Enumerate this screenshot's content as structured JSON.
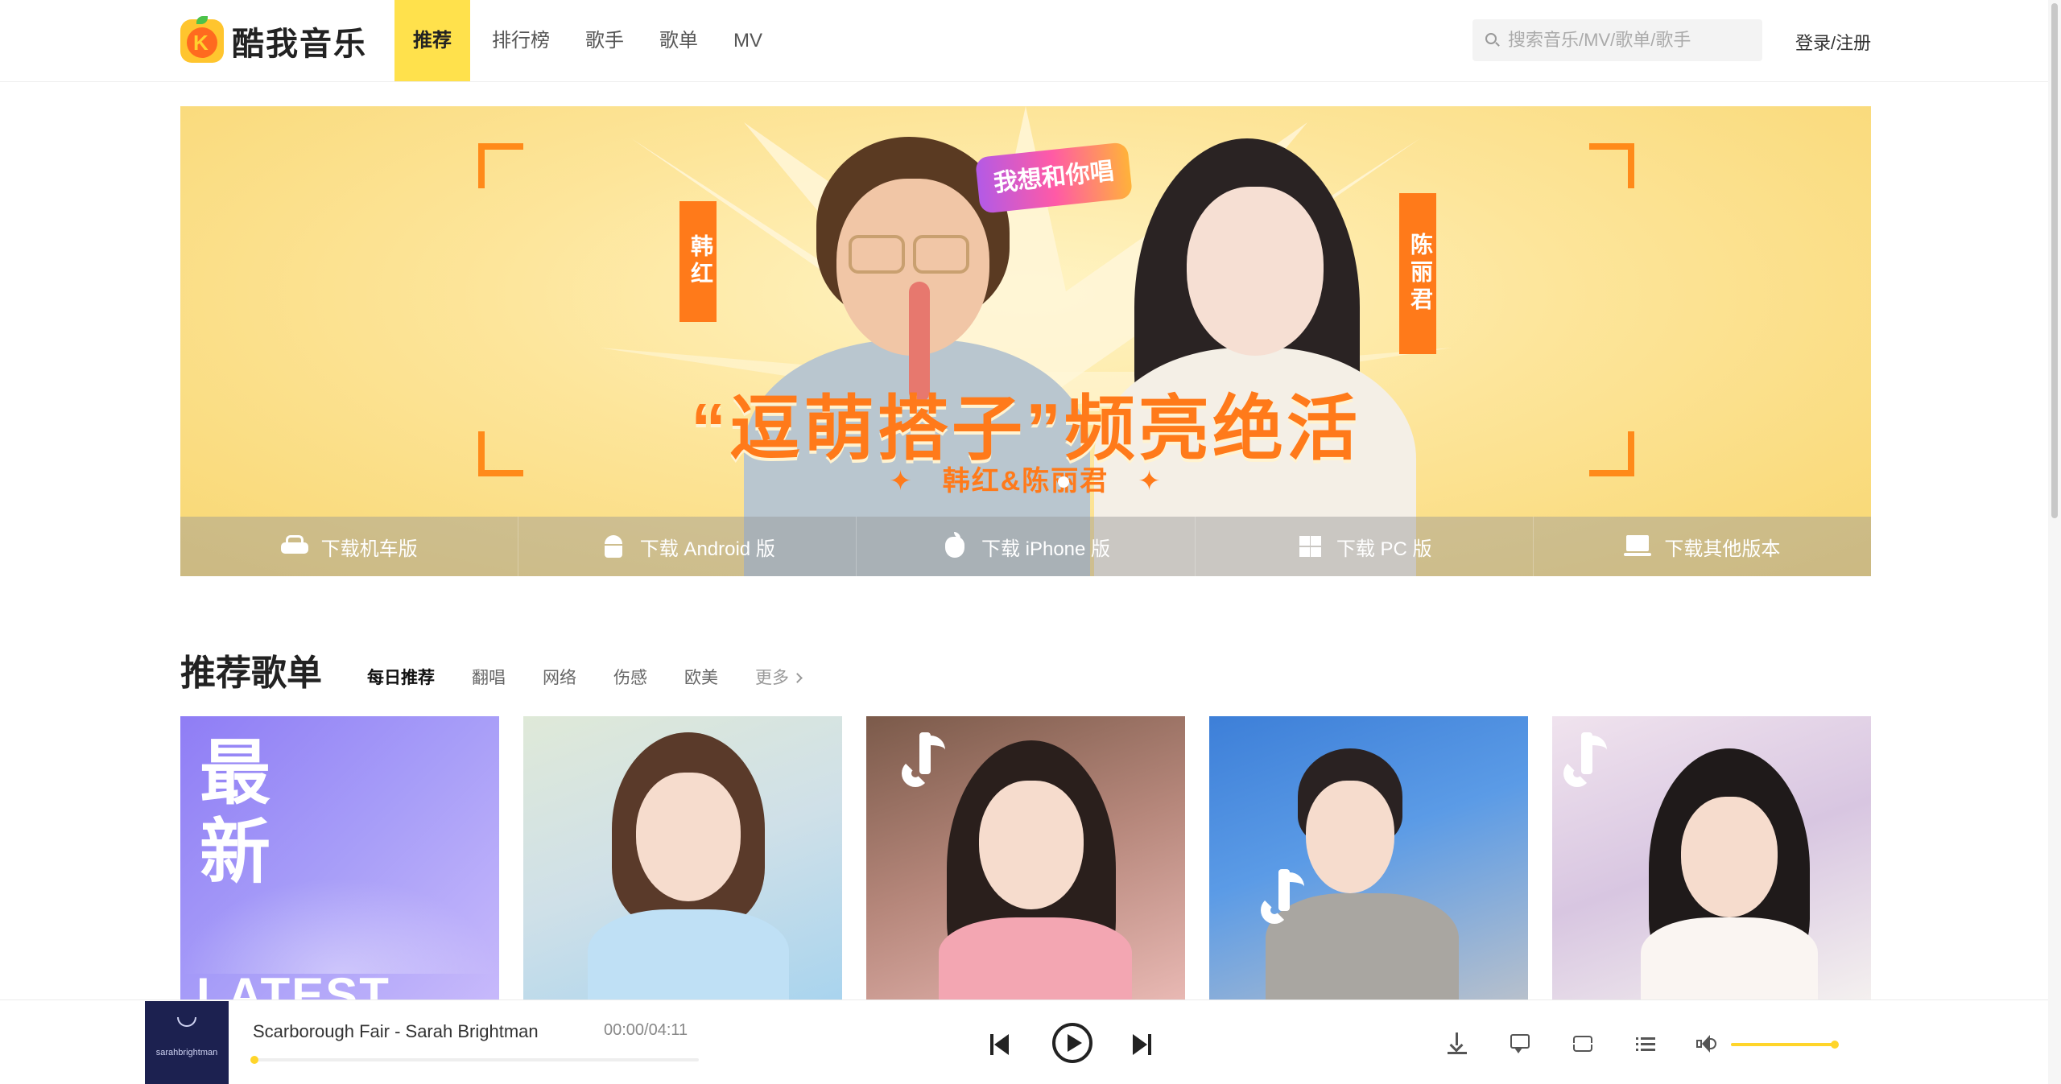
{
  "app": {
    "name": "酷我音乐",
    "accent_color": "#ffe14c"
  },
  "nav": {
    "items": [
      {
        "label": "推荐",
        "active": true
      },
      {
        "label": "排行榜",
        "active": false
      },
      {
        "label": "歌手",
        "active": false
      },
      {
        "label": "歌单",
        "active": false
      },
      {
        "label": "MV",
        "active": false
      }
    ]
  },
  "search": {
    "placeholder": "搜索音乐/MV/歌单/歌手",
    "value": ""
  },
  "login_label": "登录/注册",
  "banner": {
    "headline": "“逗萌搭子”频亮绝活",
    "subline": "韩红&陈丽君",
    "tag_left": "韩红",
    "tag_right": "陈丽君",
    "show_logo": "我想和你唱"
  },
  "downloads": [
    {
      "label": "下载机车版",
      "icon": "car-icon"
    },
    {
      "label": "下载 Android 版",
      "icon": "android-icon"
    },
    {
      "label": "下载 iPhone 版",
      "icon": "apple-icon"
    },
    {
      "label": "下载 PC 版",
      "icon": "windows-icon"
    },
    {
      "label": "下载其他版本",
      "icon": "laptop-icon"
    }
  ],
  "section": {
    "title": "推荐歌单",
    "tabs": [
      {
        "label": "每日推荐",
        "active": true
      },
      {
        "label": "翻唱",
        "active": false
      },
      {
        "label": "网络",
        "active": false
      },
      {
        "label": "伤感",
        "active": false
      },
      {
        "label": "欧美",
        "active": false
      }
    ],
    "more_label": "更多"
  },
  "cards": [
    {
      "big_text": "最新",
      "sub_text": "LATEST"
    },
    {},
    {},
    {},
    {}
  ],
  "player": {
    "song": "Scarborough Fair - Sarah Brightman",
    "current_time": "00:00",
    "total_time": "04:11",
    "time_display": "00:00/04:11",
    "progress": 0,
    "volume": 1.0,
    "album_text": "sarahbrightman"
  }
}
